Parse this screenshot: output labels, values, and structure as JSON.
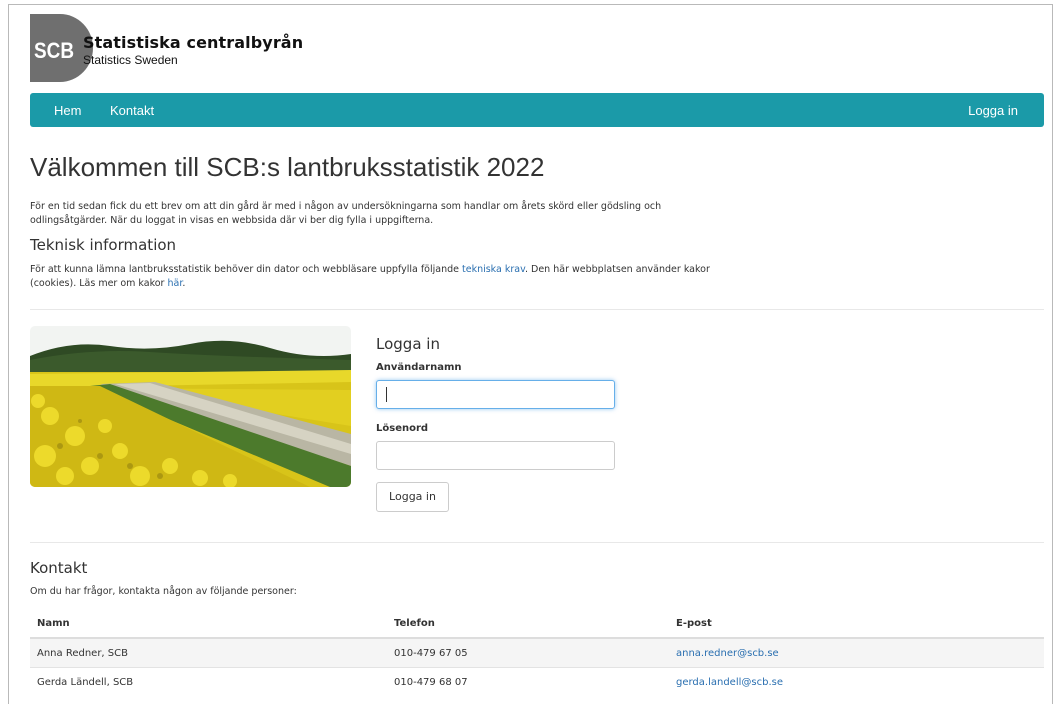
{
  "brand": {
    "logo_mark": "SCB",
    "name": "Statistiska centralbyrån",
    "tagline": "Statistics Sweden"
  },
  "nav": {
    "home": "Hem",
    "contact": "Kontakt",
    "login": "Logga in"
  },
  "page": {
    "title": "Välkommen till SCB:s lantbruksstatistik 2022",
    "intro": "För en tid sedan fick du ett brev om att din gård är med i någon av undersökningarna som handlar om årets skörd eller gödsling och odlingsåtgärder. När du loggat in visas en webbsida där vi ber dig fylla i uppgifterna.",
    "tech_heading": "Teknisk information",
    "tech_text_1": "För att kunna lämna lantbruksstatistik behöver din dator och webbläsare uppfylla följande ",
    "tech_link_1": "tekniska krav",
    "tech_text_2": ". Den här webbplatsen använder kakor (cookies). Läs mer om kakor ",
    "tech_link_2": "här",
    "tech_text_3": "."
  },
  "login": {
    "heading": "Logga in",
    "username_label": "Användarnamn",
    "username_value": "",
    "password_label": "Lösenord",
    "password_value": "",
    "submit": "Logga in"
  },
  "contact": {
    "heading": "Kontakt",
    "text": "Om du har frågor, kontakta någon av följande personer:",
    "columns": [
      "Namn",
      "Telefon",
      "E-post"
    ],
    "rows": [
      {
        "name": "Anna Redner, SCB",
        "phone": "010-479 67 05",
        "email": "anna.redner@scb.se"
      },
      {
        "name": "Gerda Ländell, SCB",
        "phone": "010-479 68 07",
        "email": "gerda.landell@scb.se"
      }
    ]
  },
  "colors": {
    "navbar": "#1b9aa8",
    "link": "#2a6fb0",
    "logo_grey": "#6f6f6f"
  }
}
